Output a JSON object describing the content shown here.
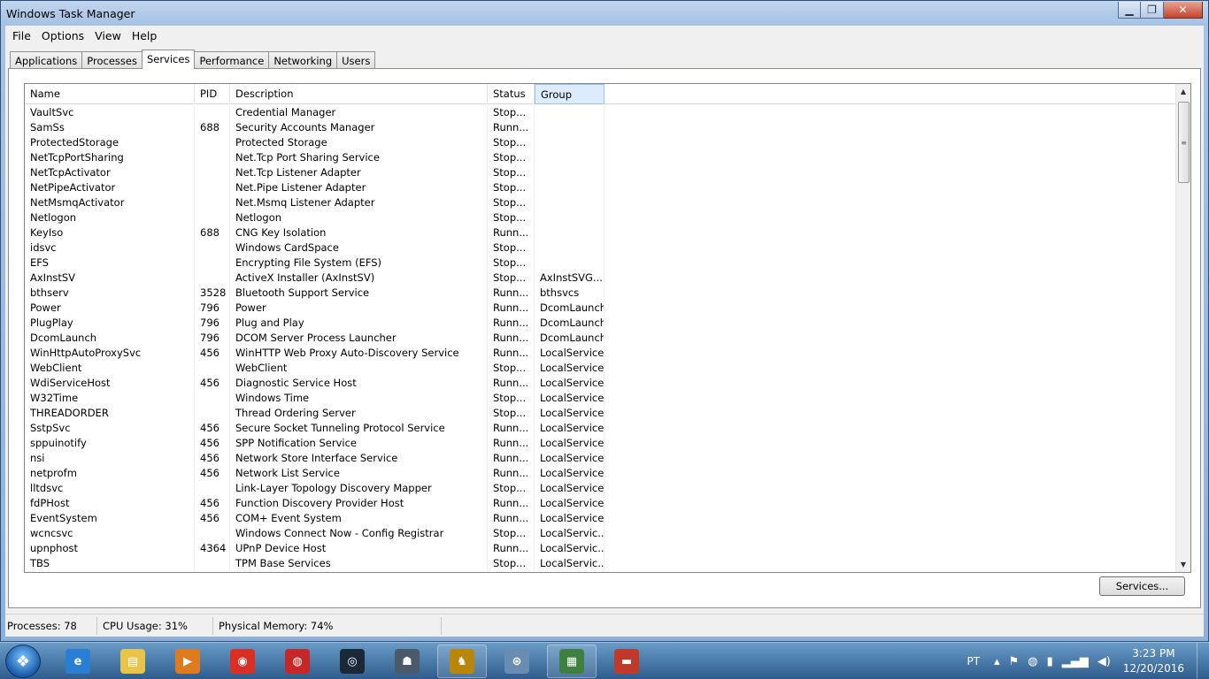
{
  "window": {
    "title": "Windows Task Manager"
  },
  "menu": [
    "File",
    "Options",
    "View",
    "Help"
  ],
  "tabs": [
    "Applications",
    "Processes",
    "Services",
    "Performance",
    "Networking",
    "Users"
  ],
  "active_tab": "Services",
  "columns": {
    "name": "Name",
    "pid": "PID",
    "description": "Description",
    "status": "Status",
    "group": "Group"
  },
  "services": [
    [
      "VaultSvc",
      "",
      "Credential Manager",
      "Stop...",
      ""
    ],
    [
      "SamSs",
      "688",
      "Security Accounts Manager",
      "Runn...",
      ""
    ],
    [
      "ProtectedStorage",
      "",
      "Protected Storage",
      "Stop...",
      ""
    ],
    [
      "NetTcpPortSharing",
      "",
      "Net.Tcp Port Sharing Service",
      "Stop...",
      ""
    ],
    [
      "NetTcpActivator",
      "",
      "Net.Tcp Listener Adapter",
      "Stop...",
      ""
    ],
    [
      "NetPipeActivator",
      "",
      "Net.Pipe Listener Adapter",
      "Stop...",
      ""
    ],
    [
      "NetMsmqActivator",
      "",
      "Net.Msmq Listener Adapter",
      "Stop...",
      ""
    ],
    [
      "Netlogon",
      "",
      "Netlogon",
      "Stop...",
      ""
    ],
    [
      "KeyIso",
      "688",
      "CNG Key Isolation",
      "Runn...",
      ""
    ],
    [
      "idsvc",
      "",
      "Windows CardSpace",
      "Stop...",
      ""
    ],
    [
      "EFS",
      "",
      "Encrypting File System (EFS)",
      "Stop...",
      ""
    ],
    [
      "AxInstSV",
      "",
      "ActiveX Installer (AxInstSV)",
      "Stop...",
      "AxInstSVG..."
    ],
    [
      "bthserv",
      "3528",
      "Bluetooth Support Service",
      "Runn...",
      "bthsvcs"
    ],
    [
      "Power",
      "796",
      "Power",
      "Runn...",
      "DcomLaunch"
    ],
    [
      "PlugPlay",
      "796",
      "Plug and Play",
      "Runn...",
      "DcomLaunch"
    ],
    [
      "DcomLaunch",
      "796",
      "DCOM Server Process Launcher",
      "Runn...",
      "DcomLaunch"
    ],
    [
      "WinHttpAutoProxySvc",
      "456",
      "WinHTTP Web Proxy Auto-Discovery Service",
      "Runn...",
      "LocalService"
    ],
    [
      "WebClient",
      "",
      "WebClient",
      "Stop...",
      "LocalService"
    ],
    [
      "WdiServiceHost",
      "456",
      "Diagnostic Service Host",
      "Runn...",
      "LocalService"
    ],
    [
      "W32Time",
      "",
      "Windows Time",
      "Stop...",
      "LocalService"
    ],
    [
      "THREADORDER",
      "",
      "Thread Ordering Server",
      "Stop...",
      "LocalService"
    ],
    [
      "SstpSvc",
      "456",
      "Secure Socket Tunneling Protocol Service",
      "Runn...",
      "LocalService"
    ],
    [
      "sppuinotify",
      "456",
      "SPP Notification Service",
      "Runn...",
      "LocalService"
    ],
    [
      "nsi",
      "456",
      "Network Store Interface Service",
      "Runn...",
      "LocalService"
    ],
    [
      "netprofm",
      "456",
      "Network List Service",
      "Runn...",
      "LocalService"
    ],
    [
      "lltdsvc",
      "",
      "Link-Layer Topology Discovery Mapper",
      "Stop...",
      "LocalService"
    ],
    [
      "fdPHost",
      "456",
      "Function Discovery Provider Host",
      "Runn...",
      "LocalService"
    ],
    [
      "EventSystem",
      "456",
      "COM+ Event System",
      "Runn...",
      "LocalService"
    ],
    [
      "wcncsvc",
      "",
      "Windows Connect Now - Config Registrar",
      "Stop...",
      "LocalServic..."
    ],
    [
      "upnphost",
      "4364",
      "UPnP Device Host",
      "Runn...",
      "LocalServic..."
    ],
    [
      "TBS",
      "",
      "TPM Base Services",
      "Stop...",
      "LocalServic..."
    ]
  ],
  "buttons": {
    "services": "Services..."
  },
  "statusbar": {
    "processes": "Processes: 78",
    "cpu": "CPU Usage: 31%",
    "memory": "Physical Memory: 74%"
  },
  "taskbar": {
    "apps": [
      {
        "icon": "internet-explorer-icon",
        "color": "#2a7fd4",
        "glyph": "e",
        "open": false
      },
      {
        "icon": "file-explorer-icon",
        "color": "#e8c44a",
        "glyph": "▤",
        "open": false
      },
      {
        "icon": "media-player-icon",
        "color": "#e07a1f",
        "glyph": "▶",
        "open": false
      },
      {
        "icon": "chrome-icon",
        "color": "#d93025",
        "glyph": "◉",
        "open": false
      },
      {
        "icon": "globe-app-icon",
        "color": "#c62828",
        "glyph": "◍",
        "open": false
      },
      {
        "icon": "steam-icon",
        "color": "#1b2838",
        "glyph": "◎",
        "open": false
      },
      {
        "icon": "game-icon",
        "color": "#4a5a6a",
        "glyph": "☗",
        "open": false
      },
      {
        "icon": "game-badge-icon",
        "color": "#b8860b",
        "glyph": "♞",
        "open": true
      },
      {
        "icon": "network-tool-icon",
        "color": "#6a8cb0",
        "glyph": "⊛",
        "open": false
      },
      {
        "icon": "task-manager-icon",
        "color": "#3f7f3f",
        "glyph": "▦",
        "open": true
      },
      {
        "icon": "toolbox-icon",
        "color": "#c0392b",
        "glyph": "▬",
        "open": false
      }
    ],
    "language": "PT",
    "time": "3:23 PM",
    "date": "12/20/2016"
  }
}
